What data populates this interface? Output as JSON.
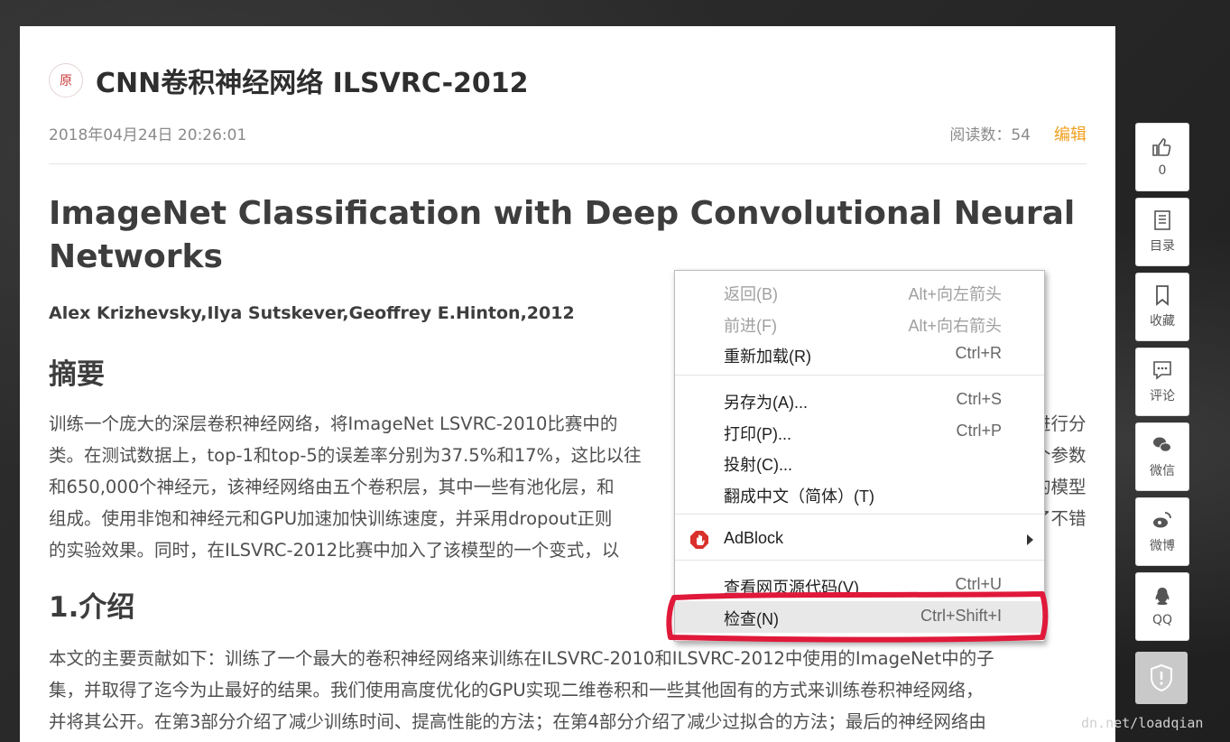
{
  "article": {
    "badge": "原",
    "title": "CNN卷积神经网络 ILSVRC-2012",
    "date": "2018年04月24日 20:26:01",
    "reads": "阅读数：54",
    "edit": "编辑",
    "heading": "ImageNet Classification with Deep Convolutional Neural Networks",
    "authors": "Alex Krizhevsky,Ilya Sutskever,Geoffrey E.Hinton,2012",
    "abstract_heading": "摘要",
    "abstract_lines": [
      "训练一个庞大的深层卷积神经网络，将ImageNet LSVRC-2010比赛中的",
      "类。在测试数据上，top-1和top-5的误差率分别为37.5%和17%，这比以往",
      "和650,000个神经元，该神经网络由五个卷积层，其中一些有池化层，和",
      "组成。使用非饱和神经元和GPU加速加快训练速度，并采用dropout正则",
      "的实验效果。同时，在ILSVRC-2012比赛中加入了该模型的一个变式，以"
    ],
    "right_fragments": [
      "进行分",
      "个参数",
      "的模型",
      "了不错"
    ],
    "intro_heading": "1.介绍",
    "intro_lines": [
      "本文的主要贡献如下：训练了一个最大的卷积神经网络来训练在ILSVRC-2010和ILSVRC-2012中使用的ImageNet中的子",
      "集，并取得了迄今为止最好的结果。我们使用高度优化的GPU实现二维卷积和一些其他固有的方式来训练卷积神经网络，",
      "并将其公开。在第3部分介绍了减少训练时间、提高性能的方法；在第4部分介绍了减少过拟合的方法；最后的神经网络由"
    ]
  },
  "sidebar": {
    "like_count": "0",
    "toc": "目录",
    "favorite": "收藏",
    "comment": "评论",
    "wechat": "微信",
    "weibo": "微博",
    "qq": "QQ"
  },
  "watermark": "dn.net/loadqian",
  "context_menu": {
    "items": [
      {
        "label": "返回(B)",
        "shortcut": "Alt+向左箭头",
        "disabled": true
      },
      {
        "label": "前进(F)",
        "shortcut": "Alt+向右箭头",
        "disabled": true
      },
      {
        "label": "重新加载(R)",
        "shortcut": "Ctrl+R"
      },
      {
        "label": "另存为(A)...",
        "shortcut": "Ctrl+S"
      },
      {
        "label": "打印(P)...",
        "shortcut": "Ctrl+P"
      },
      {
        "label": "投射(C)..."
      },
      {
        "label": "翻成中文（简体）(T)"
      },
      {
        "label": "AdBlock"
      },
      {
        "label": "查看网页源代码(V)",
        "shortcut": "Ctrl+U"
      },
      {
        "label": "检查(N)",
        "shortcut": "Ctrl+Shift+I",
        "highlighted": true
      }
    ]
  },
  "colors": {
    "accent": "#f0a020",
    "highlight_marker": "#e0193a",
    "adblock_red": "#d9302c"
  }
}
